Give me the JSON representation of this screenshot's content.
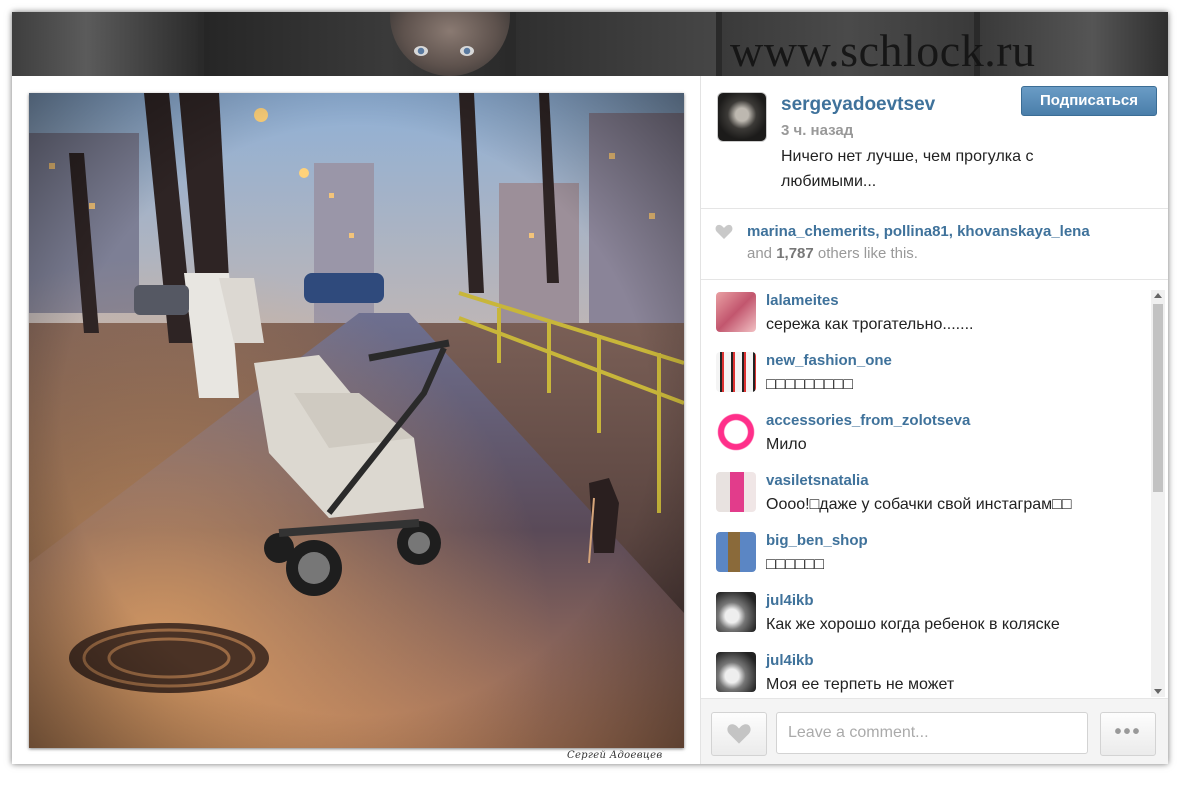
{
  "background": {
    "watermark": "www.schlock.ru"
  },
  "post": {
    "photo_signature": "Сергей Адоевцев",
    "username": "sergeyadoevtsev",
    "time": "3 ч. назад",
    "caption": "Ничего нет лучше, чем прогулка с любимыми...",
    "follow_label": "Подписаться",
    "accent_color": "#3f729b"
  },
  "likes": {
    "names": "marina_chemerits, pollina81, khovanskaya_lena",
    "and_label": "and",
    "count": "1,787",
    "suffix": "others like this."
  },
  "comments": [
    {
      "user": "lalameites",
      "text": "сережа как трогательно.......",
      "avatar": "nails"
    },
    {
      "user": "new_fashion_one",
      "text": "□□□□□□□□□",
      "avatar": "figures"
    },
    {
      "user": "accessories_from_zolotseva",
      "text": "Мило",
      "avatar": "pink-ring"
    },
    {
      "user": "vasiletsnatalia",
      "text": "Оооо!□даже у собачки свой инстаграм□□",
      "avatar": "pink-dress"
    },
    {
      "user": "big_ben_shop",
      "text": "□□□□□□",
      "avatar": "big-ben"
    },
    {
      "user": "jul4ikb",
      "text": "Как же хорошо когда ребенок в коляске",
      "avatar": "bw-photo"
    },
    {
      "user": "jul4ikb",
      "text": "Моя ее терпеть не может",
      "avatar": "bw-photo"
    }
  ],
  "footer": {
    "comment_placeholder": "Leave a comment...",
    "like_icon": "heart-icon",
    "more_label": "•••"
  }
}
